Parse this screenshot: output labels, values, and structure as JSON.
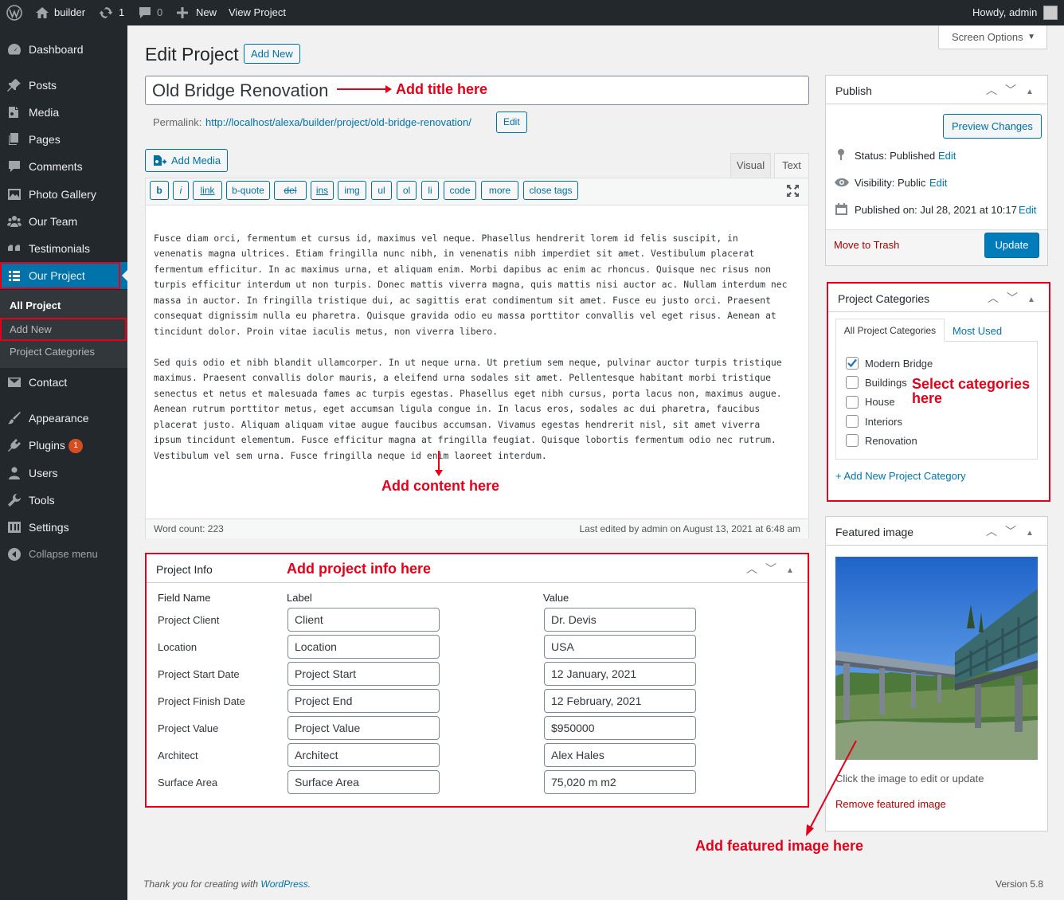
{
  "adminbar": {
    "site_name": "builder",
    "updates_count": "1",
    "comments_count": "0",
    "new_label": "New",
    "view_label": "View Project",
    "howdy": "Howdy, admin"
  },
  "menu": {
    "items": [
      {
        "label": "Dashboard",
        "icon": "dashboard-icon"
      },
      {
        "label": "Posts",
        "icon": "pin-icon"
      },
      {
        "label": "Media",
        "icon": "media-icon"
      },
      {
        "label": "Pages",
        "icon": "page-icon"
      },
      {
        "label": "Comments",
        "icon": "comment-icon"
      },
      {
        "label": "Photo Gallery",
        "icon": "gallery-icon"
      },
      {
        "label": "Our Team",
        "icon": "team-icon"
      },
      {
        "label": "Testimonials",
        "icon": "quote-icon"
      },
      {
        "label": "Our Project",
        "icon": "list-icon"
      },
      {
        "label": "Contact",
        "icon": "mail-icon"
      },
      {
        "label": "Appearance",
        "icon": "brush-icon"
      },
      {
        "label": "Plugins",
        "icon": "plugin-icon"
      },
      {
        "label": "Users",
        "icon": "user-icon"
      },
      {
        "label": "Tools",
        "icon": "wrench-icon"
      },
      {
        "label": "Settings",
        "icon": "settings-icon"
      },
      {
        "label": "Collapse menu",
        "icon": "collapse-icon"
      }
    ],
    "plugins_badge": "1",
    "submenu": [
      "All Project",
      "Add New",
      "Project Categories"
    ]
  },
  "screen_options": "Screen Options",
  "page": {
    "title": "Edit Project",
    "add_new": "Add New",
    "post_title": "Old Bridge Renovation",
    "permalink_label": "Permalink:",
    "permalink_url": "http://localhost/alexa/builder/project/old-bridge-renovation/",
    "permalink_edit": "Edit"
  },
  "editor": {
    "add_media": "Add Media",
    "tab_visual": "Visual",
    "tab_text": "Text",
    "quicktags": [
      "b",
      "i",
      "link",
      "b-quote",
      "del",
      "ins",
      "img",
      "ul",
      "ol",
      "li",
      "code",
      "more",
      "close tags"
    ],
    "lines": [
      "Fusce diam orci, fermentum et cursus id, maximus vel neque. Phasellus hendrerit lorem id felis suscipit, in",
      "venenatis magna ultrices. Etiam fringilla nunc nibh, in venenatis nibh imperdiet sit amet. Vestibulum placerat",
      "fermentum efficitur. In ac maximus urna, et aliquam enim. Morbi dapibus ac enim ac rhoncus. Quisque nec risus non",
      "turpis efficitur interdum ut non turpis. Donec mattis viverra magna, quis mattis nisi auctor ac. Nullam interdum nec",
      "massa in auctor. In fringilla tristique dui, ac sagittis erat condimentum sit amet. Fusce eu justo orci. Praesent",
      "consequat dignissim nulla eu pharetra. Quisque gravida odio eu massa porttitor convallis vel eget risus. Aenean at",
      "tincidunt dolor. Proin vitae iaculis metus, non viverra libero.",
      "",
      "Sed quis odio et nibh blandit ullamcorper. In ut neque urna. Ut pretium sem neque, pulvinar auctor turpis tristique",
      "maximus. Praesent convallis dolor mauris, a eleifend urna sodales sit amet. Pellentesque habitant morbi tristique",
      "senectus et netus et malesuada fames ac turpis egestas. Phasellus eget nibh cursus, porta lacus non, maximus augue.",
      "Aenean rutrum porttitor metus, eget accumsan ligula congue in. In lacus eros, sodales ac dui pharetra, faucibus",
      "placerat justo. Aliquam aliquam vitae augue faucibus accumsan. Vivamus egestas hendrerit nisl, sit amet viverra",
      "ipsum tincidunt elementum. Fusce efficitur magna at fringilla feugiat. Quisque lobortis fermentum odio nec rutrum.",
      "Vestibulum vel sem urna. Fusce fringilla neque id enim laoreet interdum."
    ],
    "word_count": "Word count: 223",
    "last_edited": "Last edited by admin on August 13, 2021 at 6:48 am"
  },
  "project_info": {
    "title": "Project Info",
    "col_field": "Field Name",
    "col_label": "Label",
    "col_value": "Value",
    "rows": [
      {
        "field": "Project Client",
        "label": "Client",
        "value": "Dr. Devis"
      },
      {
        "field": "Location",
        "label": "Location",
        "value": "USA"
      },
      {
        "field": "Project Start Date",
        "label": "Project Start",
        "value": "12 January, 2021"
      },
      {
        "field": "Project Finish Date",
        "label": "Project End",
        "value": "12 February, 2021"
      },
      {
        "field": "Project Value",
        "label": "Project Value",
        "value": "$950000"
      },
      {
        "field": "Architect",
        "label": "Architect",
        "value": "Alex Hales"
      },
      {
        "field": "Surface Area",
        "label": "Surface Area",
        "value": "75,020 m m2"
      }
    ]
  },
  "publish": {
    "title": "Publish",
    "preview": "Preview Changes",
    "status": "Status: Published",
    "visibility": "Visibility: Public",
    "published_on": "Published on: Jul 28, 2021 at 10:17",
    "edit": "Edit",
    "trash": "Move to Trash",
    "update": "Update"
  },
  "categories": {
    "title": "Project Categories",
    "tab_all": "All Project Categories",
    "tab_used": "Most Used",
    "items": [
      {
        "label": "Modern Bridge",
        "checked": true
      },
      {
        "label": "Buildings",
        "checked": false
      },
      {
        "label": "House",
        "checked": false
      },
      {
        "label": "Interiors",
        "checked": false
      },
      {
        "label": "Renovation",
        "checked": false
      }
    ],
    "add_new": "+ Add New Project Category"
  },
  "featured": {
    "title": "Featured image",
    "hint": "Click the image to edit or update",
    "remove": "Remove featured image"
  },
  "annotations": {
    "title": "Add title here",
    "content": "Add content here",
    "project_info": "Add project info here",
    "categories_1": "Select categories",
    "categories_2": "here",
    "featured": "Add featured image here"
  },
  "footer": {
    "thanks_prefix": "Thank you for creating with ",
    "thanks_link": "WordPress",
    "thanks_suffix": ".",
    "version": "Version 5.8"
  },
  "colors": {
    "accent": "#0073aa",
    "annotation": "#e3001b",
    "menu_bg": "#23282d"
  }
}
